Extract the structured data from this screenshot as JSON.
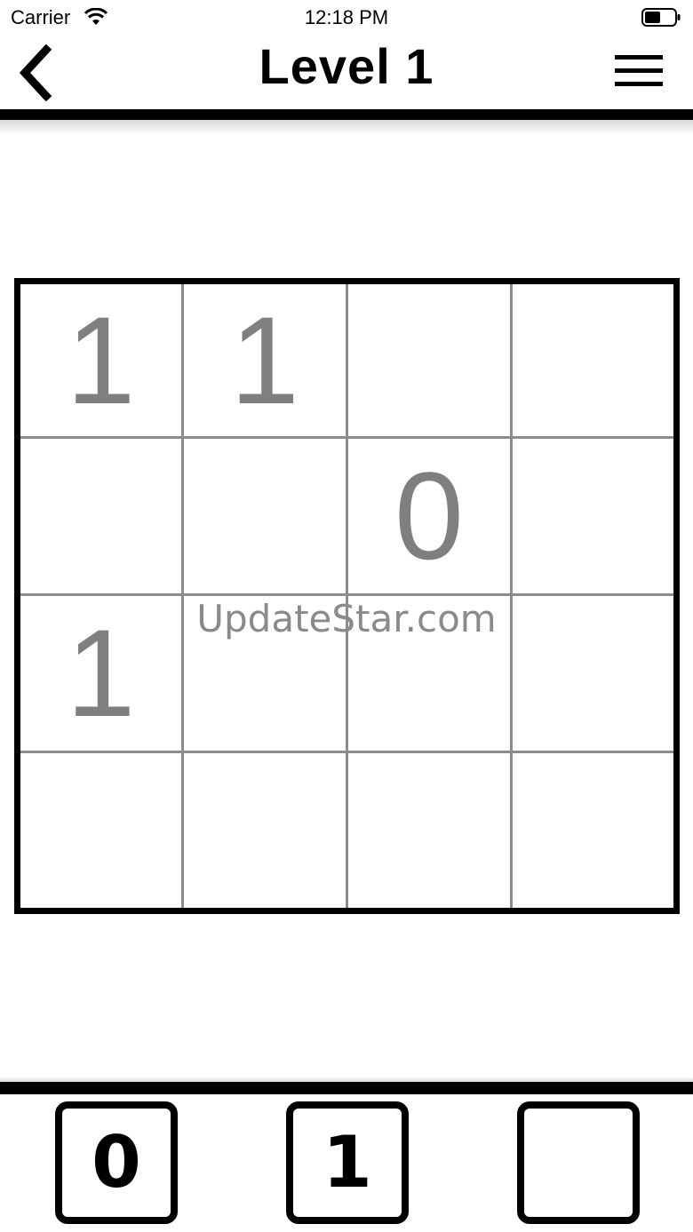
{
  "status_bar": {
    "carrier": "Carrier",
    "time": "12:18 PM"
  },
  "nav": {
    "title": "Level 1",
    "back_icon": "chevron-left-icon",
    "menu_icon": "hamburger-menu-icon"
  },
  "grid": {
    "rows": 4,
    "columns": 4,
    "cells": [
      [
        "1",
        "1",
        "",
        ""
      ],
      [
        "",
        "",
        "0",
        ""
      ],
      [
        "1",
        "",
        "",
        ""
      ],
      [
        "",
        "",
        "",
        ""
      ]
    ],
    "given_digit_color": "#7f7f7f"
  },
  "watermark": "UpdateStar.com",
  "input_buttons": [
    {
      "label": "0"
    },
    {
      "label": "1"
    },
    {
      "label": ""
    }
  ]
}
